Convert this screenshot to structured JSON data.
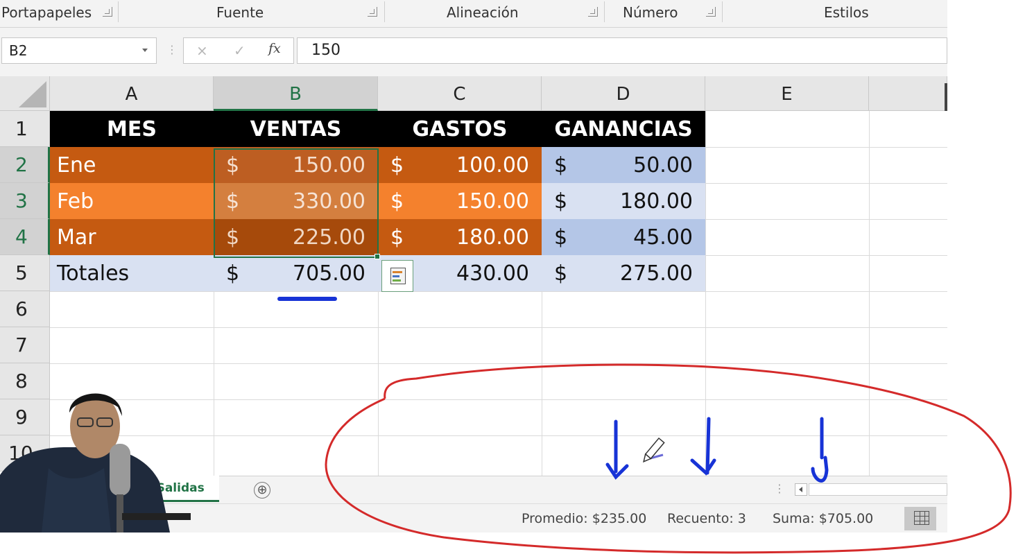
{
  "ribbon": {
    "groups": [
      "Portapapeles",
      "Fuente",
      "Alineación",
      "Número",
      "Estilos"
    ]
  },
  "formula_bar": {
    "name_box": "B2",
    "cancel_icon": "×",
    "enter_icon": "✓",
    "fx_label": "fx",
    "formula": "150"
  },
  "columns": [
    "A",
    "B",
    "C",
    "D",
    "E"
  ],
  "rows": [
    "1",
    "2",
    "3",
    "4",
    "5",
    "6",
    "7",
    "8",
    "9",
    "10"
  ],
  "table": {
    "headers": [
      "MES",
      "VENTAS",
      "GASTOS",
      "GANANCIAS"
    ],
    "currency": "$",
    "data": [
      {
        "mes": "Ene",
        "ventas": "150.00",
        "gastos": "100.00",
        "ganancias": "50.00"
      },
      {
        "mes": "Feb",
        "ventas": "330.00",
        "gastos": "150.00",
        "ganancias": "180.00"
      },
      {
        "mes": "Mar",
        "ventas": "225.00",
        "gastos": "180.00",
        "ganancias": "45.00"
      }
    ],
    "totals": {
      "label": "Totales",
      "ventas": "705.00",
      "gastos": "430.00",
      "ganancias": "275.00"
    }
  },
  "sheet_tabs": {
    "active": "asSalidas",
    "add_icon": "⊕"
  },
  "status_bar": {
    "promedio": "Promedio: $235.00",
    "recuento": "Recuento: 3",
    "suma": "Suma: $705.00"
  },
  "colors": {
    "excel_green": "#217346",
    "orange_dark": "#c55a11",
    "orange_light": "#f4812d",
    "blue_dark": "#b4c6e7",
    "blue_light": "#d9e1f2",
    "annotation_red": "#d42a2a",
    "annotation_blue": "#1733d6"
  }
}
